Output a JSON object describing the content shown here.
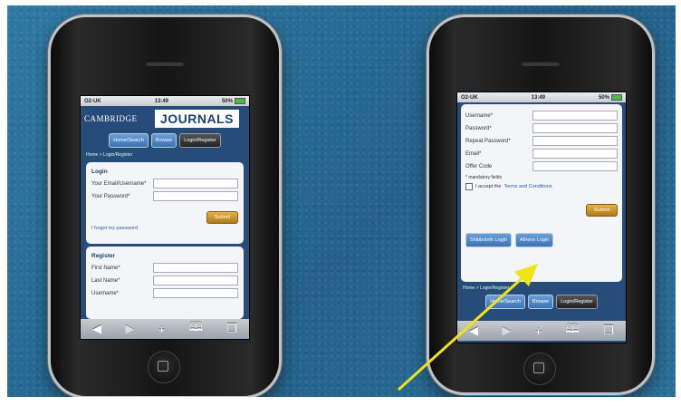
{
  "phone_left": {
    "status": {
      "carrier": "O2-UK",
      "time": "13:49",
      "battery": "50%"
    },
    "brand_text": "CAMBRIDGE",
    "brand_logo": "JOURNALS",
    "nav": {
      "home_search": "Home/Search",
      "browse": "Browse",
      "login_register": "Login/Register"
    },
    "breadcrumb": "Home > Login/Register",
    "login": {
      "title": "Login",
      "email_label": "Your Email/Username*",
      "password_label": "Your Password*",
      "submit": "Submit",
      "forgot": "I forgot my password"
    },
    "register": {
      "title": "Register",
      "first_name_label": "First Name*",
      "last_name_label": "Last Name*",
      "username_label": "Username*"
    },
    "toolbar_icons": [
      "back-icon",
      "forward-icon",
      "add-icon",
      "bookmarks-icon",
      "pages-icon"
    ]
  },
  "phone_right": {
    "status": {
      "carrier": "O2-UK",
      "time": "13:49",
      "battery": "50%"
    },
    "form": {
      "username_label": "Username*",
      "password_label": "Password*",
      "repeat_password_label": "Repeat Password*",
      "email_label": "Email*",
      "offer_code_label": "Offer Code",
      "mandatory_note": "* mandatory fields",
      "terms_prefix": "I accept the",
      "terms_link": "Terms and Conditions",
      "submit": "Submit",
      "shibboleth_login": "Shibboleth Login",
      "athens_login": "Athens Login"
    },
    "breadcrumb": "Home > Login/Register",
    "nav": {
      "home_search": "Home/Search",
      "browse": "Browse",
      "login_register": "Login/Register"
    },
    "toolbar_icons": [
      "back-icon",
      "forward-icon",
      "add-icon",
      "bookmarks-icon",
      "pages-icon"
    ]
  },
  "annotation": {
    "arrow_color": "#f2e21a"
  },
  "colors": {
    "background": "#2c6d95",
    "header": "#284c7a",
    "accent_button": "#3a72b4",
    "submit": "#c8901f"
  }
}
